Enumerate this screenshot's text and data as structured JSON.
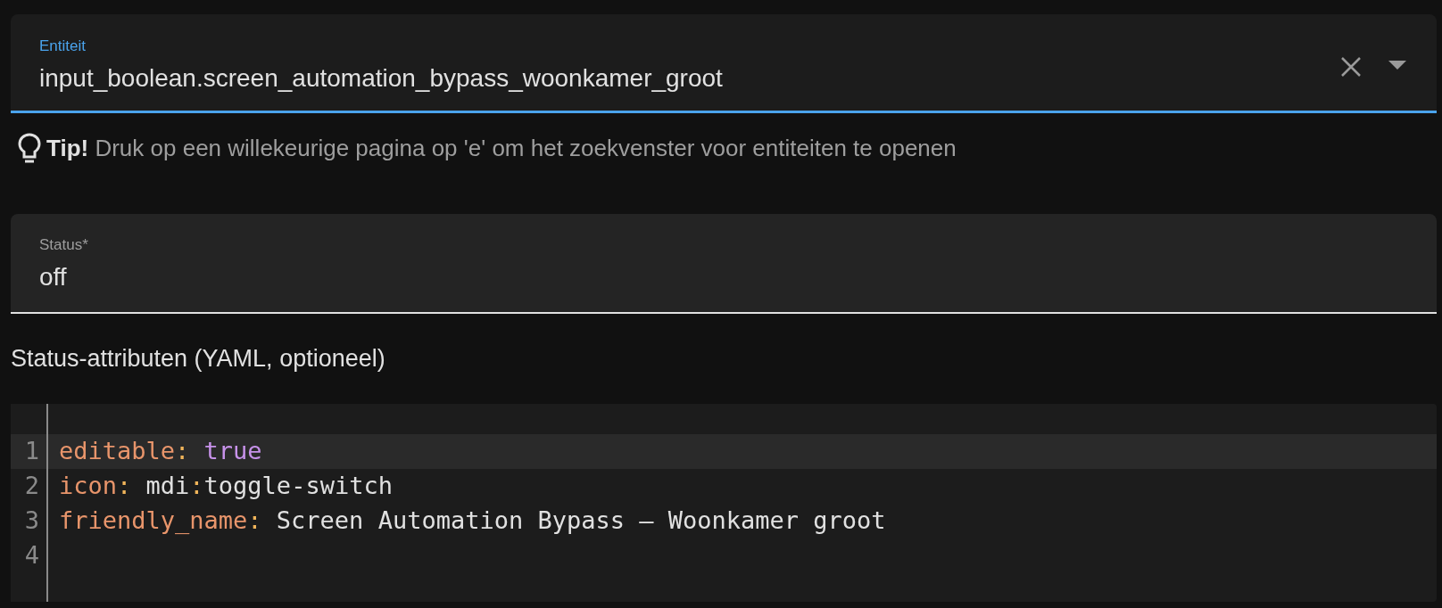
{
  "entity_field": {
    "label": "Entiteit",
    "value": "input_boolean.screen_automation_bypass_woonkamer_groot",
    "focused": true
  },
  "tip": {
    "title": "Tip!",
    "text": "Druk op een willekeurige pagina op 'e' om het zoekvenster voor entiteiten te openen"
  },
  "status_field": {
    "label": "Status*",
    "value": "off"
  },
  "attributes_label": "Status-attributen (YAML, optioneel)",
  "code_editor": {
    "lines": [
      {
        "number": "1",
        "active": true,
        "tokens": [
          {
            "kind": "key",
            "text": "editable"
          },
          {
            "kind": "punct",
            "text": ": "
          },
          {
            "kind": "bool",
            "text": "true"
          }
        ]
      },
      {
        "number": "2",
        "active": false,
        "tokens": [
          {
            "kind": "key",
            "text": "icon"
          },
          {
            "kind": "punct",
            "text": ": "
          },
          {
            "kind": "plain",
            "text": "mdi"
          },
          {
            "kind": "punct",
            "text": ":"
          },
          {
            "kind": "plain",
            "text": "toggle-switch"
          }
        ]
      },
      {
        "number": "3",
        "active": false,
        "tokens": [
          {
            "kind": "key",
            "text": "friendly_name"
          },
          {
            "kind": "punct",
            "text": ": "
          },
          {
            "kind": "plain",
            "text": "Screen Automation Bypass – Woonkamer groot"
          }
        ]
      },
      {
        "number": "4",
        "active": false
      }
    ]
  }
}
